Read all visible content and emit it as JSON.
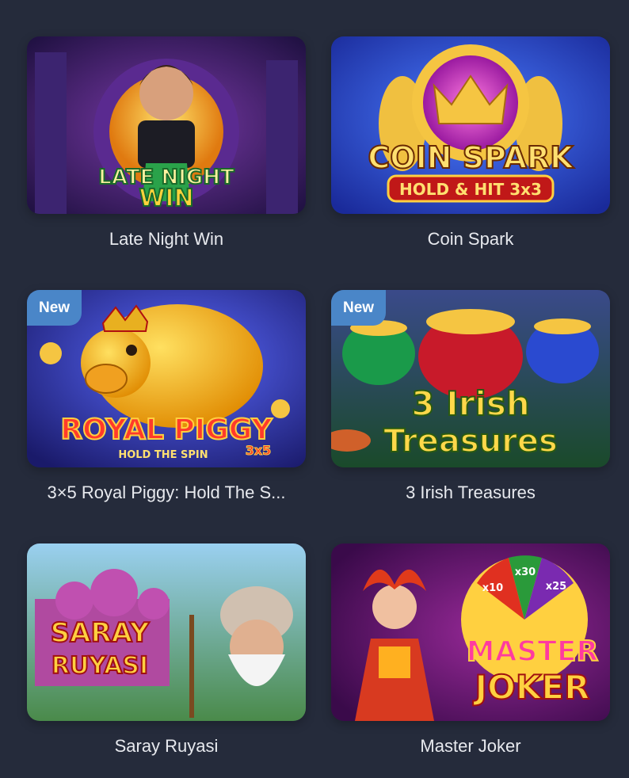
{
  "games": [
    {
      "title": "Late Night Win",
      "badge": "",
      "art_text": [
        "LATE NIGHT",
        "WIN"
      ]
    },
    {
      "title": "Coin Spark",
      "badge": "",
      "art_text": [
        "COIN SPARK",
        "HOLD & HIT 3x3"
      ]
    },
    {
      "title": "3×5 Royal Piggy: Hold The S...",
      "badge": "New",
      "art_text": [
        "ROYAL PIGGY",
        "HOLD THE SPIN",
        "3x5"
      ]
    },
    {
      "title": "3 Irish Treasures",
      "badge": "New",
      "art_text": [
        "3 Irish",
        "Treasures"
      ]
    },
    {
      "title": "Saray Ruyasi",
      "badge": "",
      "art_text": [
        "SARAY",
        "RUYASI"
      ]
    },
    {
      "title": "Master Joker",
      "badge": "",
      "art_text": [
        "MASTER",
        "JOKER",
        "x10",
        "x30",
        "x25"
      ]
    }
  ],
  "colors": {
    "background": "#252b3b",
    "title_text": "#e7e9ee",
    "new_badge": "#4a86c8"
  }
}
